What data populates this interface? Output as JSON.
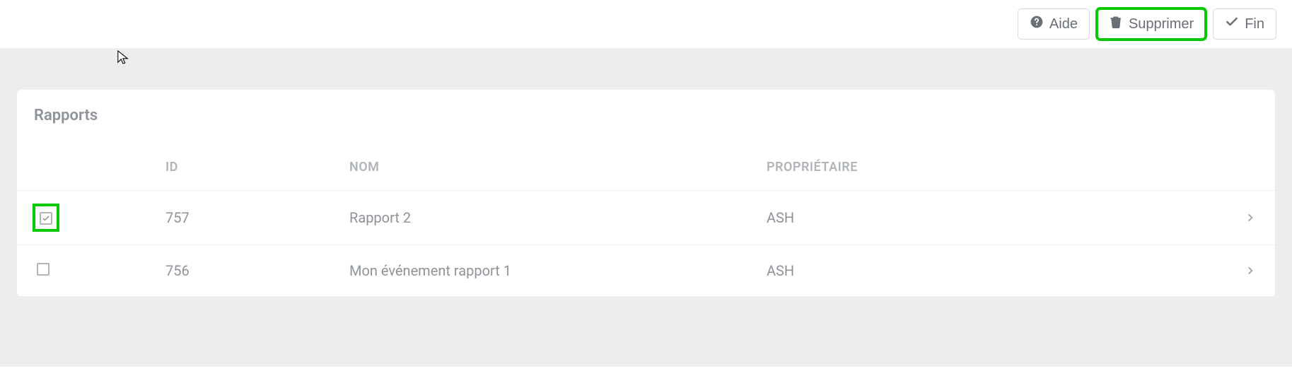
{
  "toolbar": {
    "help_label": "Aide",
    "delete_label": "Supprimer",
    "finish_label": "Fin"
  },
  "card": {
    "title": "Rapports"
  },
  "table": {
    "headers": {
      "id": "ID",
      "name": "NOM",
      "owner": "PROPRIÉTAIRE"
    },
    "rows": [
      {
        "checked": true,
        "highlighted": true,
        "id": "757",
        "name": "Rapport 2",
        "owner": "ASH"
      },
      {
        "checked": false,
        "highlighted": false,
        "id": "756",
        "name": "Mon événement rapport 1",
        "owner": "ASH"
      }
    ]
  }
}
